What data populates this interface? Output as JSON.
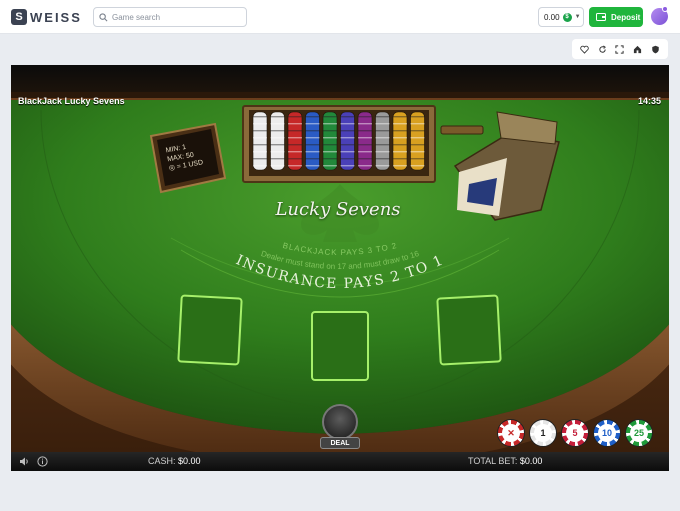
{
  "header": {
    "logo_text": "WEISS",
    "logo_mark": "S",
    "search_placeholder": "Game search",
    "balance": "0.00",
    "currency_symbol": "$",
    "deposit_label": "Deposit"
  },
  "controls": {
    "icons": [
      "heart-icon",
      "refresh-icon",
      "fullscreen-icon",
      "home-icon",
      "shield-icon"
    ]
  },
  "game": {
    "title": "BlackJack Lucky Sevens",
    "time": "14:35",
    "sign": {
      "min": "MIN: 1",
      "max": "MAX: 50",
      "rate": "= 1 USD"
    },
    "table_text": {
      "logo": "Lucky Sevens",
      "blackjack": "BLACKJACK PAYS 3 TO 2",
      "dealer_rule": "Dealer must stand on 17 and must draw to 16",
      "insurance": "INSURANCE PAYS 2 TO 1"
    },
    "deal_label": "DEAL",
    "chips": [
      {
        "label": "✕",
        "color": "#c62828"
      },
      {
        "label": "1",
        "color": "#e6e6e6"
      },
      {
        "label": "5",
        "color": "#c41e3a"
      },
      {
        "label": "10",
        "color": "#1f5fc8"
      },
      {
        "label": "25",
        "color": "#1f9a3a"
      }
    ],
    "cash_label": "CASH:",
    "cash_value": "$0.00",
    "total_bet_label": "TOTAL BET:",
    "total_bet_value": "$0.00"
  }
}
